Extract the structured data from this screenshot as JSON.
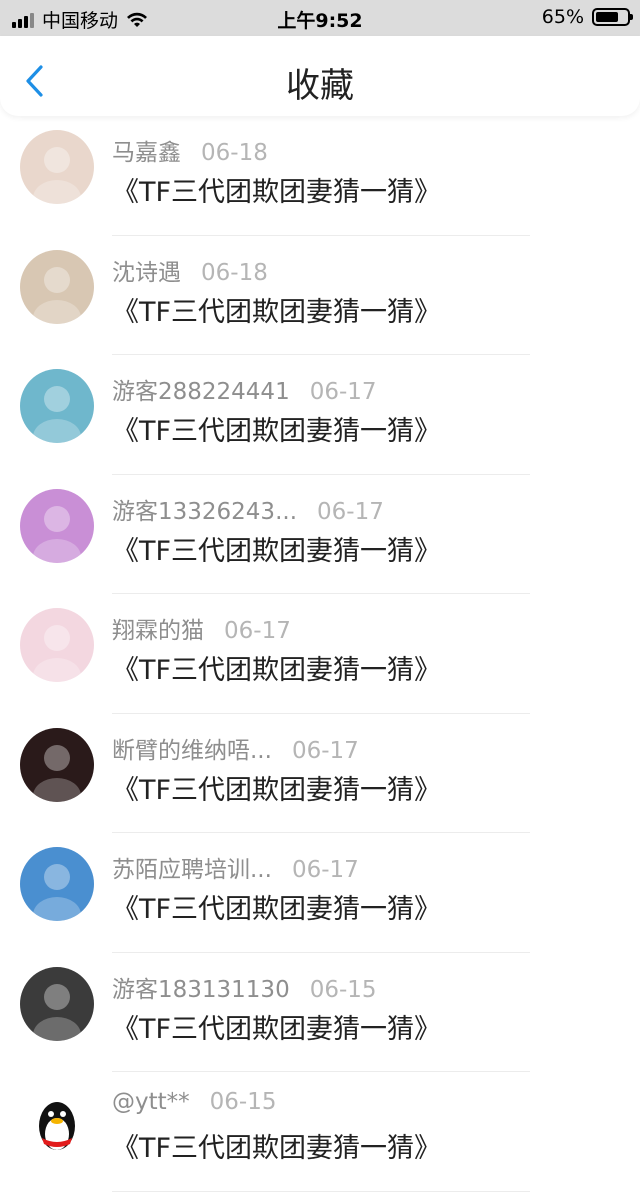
{
  "status_bar": {
    "carrier": "中国移动",
    "time": "上午9:52",
    "battery": "65%"
  },
  "nav": {
    "title": "收藏"
  },
  "items": [
    {
      "name": "马嘉鑫",
      "date": "06-18",
      "title": "《TF三代团欺团妻猜一猜》",
      "avatar_color": "#e9d7cc"
    },
    {
      "name": "沈诗遇",
      "date": "06-18",
      "title": "《TF三代团欺团妻猜一猜》",
      "avatar_color": "#d8c7b3"
    },
    {
      "name": "游客288224441",
      "date": "06-17",
      "title": "《TF三代团欺团妻猜一猜》",
      "avatar_color": "#6fb7cc"
    },
    {
      "name": "游客13326243...",
      "date": "06-17",
      "title": "《TF三代团欺团妻猜一猜》",
      "avatar_color": "#c98fd6"
    },
    {
      "name": "翔霖的猫",
      "date": "06-17",
      "title": "《TF三代团欺团妻猜一猜》",
      "avatar_color": "#f3d7e0"
    },
    {
      "name": "断臂的维纳唔...",
      "date": "06-17",
      "title": "《TF三代团欺团妻猜一猜》",
      "avatar_color": "#2a1a1a"
    },
    {
      "name": "苏陌应聘培训...",
      "date": "06-17",
      "title": "《TF三代团欺团妻猜一猜》",
      "avatar_color": "#4a8fd0"
    },
    {
      "name": "游客183131130",
      "date": "06-15",
      "title": "《TF三代团欺团妻猜一猜》",
      "avatar_color": "#3b3b3b"
    },
    {
      "name": "@ytt**",
      "date": "06-15",
      "title": "《TF三代团欺团妻猜一猜》",
      "avatar_color": "#ffffff"
    }
  ]
}
